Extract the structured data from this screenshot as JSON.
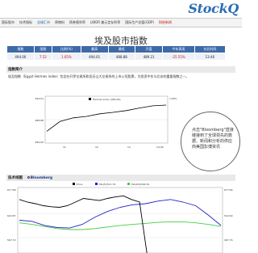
{
  "brand": {
    "logo_text": "StockQ"
  },
  "nav": [
    {
      "label": "国际股市",
      "state": "normal"
    },
    {
      "label": "技术指标",
      "state": "normal"
    },
    {
      "label": "全球汇市",
      "state": "active"
    },
    {
      "label": "原物料",
      "state": "normal"
    },
    {
      "label": "债券殖利率",
      "state": "normal"
    },
    {
      "label": "LIBOR 美元定存利率",
      "state": "normal"
    },
    {
      "label": "国际生产总值(GDP)",
      "state": "normal"
    },
    {
      "label": "财经新闻",
      "state": "red"
    }
  ],
  "page_title": "埃及股市指数",
  "quote_table": {
    "headers": [
      "指数",
      "涨跌",
      "比例(%)",
      "最高",
      "最低",
      "开盘",
      "今年表现",
      "台北时间"
    ],
    "row": [
      "494.00",
      "7.52",
      "1.65%",
      "494.01",
      "488.88",
      "489.21",
      "-25.55%",
      "13:46"
    ]
  },
  "section_intro": "指数简介",
  "intro_text": "埃及指数（Egypt Hermes index）包含在开罗交易所和亚历山大交易所的上市公司股票，为投资中东与北非的重要指数之一。",
  "chart1": {
    "legend": "Hermes index (494.00)",
    "y_ticks": [
      "494.01",
      "488.88",
      "484.00"
    ],
    "x_ticks": [
      "11",
      "12",
      "13",
      "14:00"
    ],
    "right_ticks": [
      "1.60%"
    ]
  },
  "callout": {
    "text": "点击\"Bloomberg\"直接链接到了全球领先的数据、新闻和分析的供应商美国彭博资讯"
  },
  "section_tech": "技术线图",
  "bloomberg_badge": "Bloomberg",
  "chart2": {
    "legend": [
      "Price",
      "MA(5)/511.70",
      "MA(20)/504.54"
    ],
    "y_ticks_left": [
      "677.66",
      "622.87",
      "567.70"
    ],
    "y_ticks_right": [
      "677.66",
      "522.69",
      "467.76"
    ]
  },
  "chart_data": [
    {
      "type": "line",
      "title": "",
      "xlabel": "",
      "ylabel": "",
      "x": [
        "11",
        "12",
        "13",
        "14:00"
      ],
      "series": [
        {
          "name": "Hermes index (494.00)",
          "values": [
            486.8,
            489.5,
            490.5,
            490.9,
            491.6,
            492.0,
            492.5,
            493.2,
            493.8,
            494.0
          ]
        }
      ]
    },
    {
      "type": "line",
      "title": "",
      "xlabel": "",
      "ylabel": "",
      "series": [
        {
          "name": "Price",
          "values": [
            660,
            655,
            652,
            648,
            646,
            645,
            648,
            655,
            662,
            660,
            658,
            662,
            665,
            667,
            660,
            655,
            548
          ]
        },
        {
          "name": "MA(5)/511.70",
          "values": [
            620,
            618,
            610,
            606,
            605,
            612,
            626,
            637,
            645,
            650,
            652,
            657,
            660,
            655,
            648,
            630,
            610
          ]
        },
        {
          "name": "MA(20)/504.54",
          "values": [
            615,
            612,
            608,
            604,
            602,
            602,
            604,
            607,
            610,
            612,
            614,
            616,
            617,
            617,
            615,
            612,
            608
          ]
        }
      ]
    }
  ]
}
